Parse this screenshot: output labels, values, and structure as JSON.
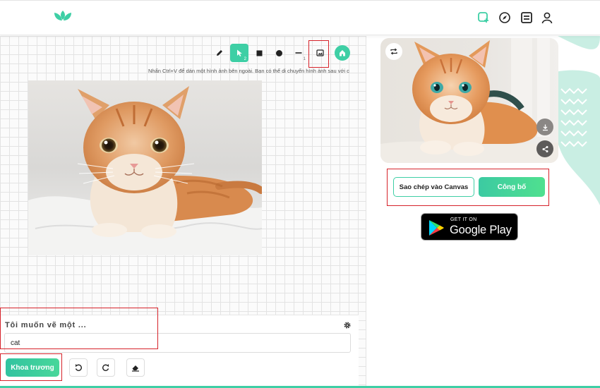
{
  "header": {
    "icons": [
      "logo-icon",
      "new-canvas-icon",
      "explore-icon",
      "gallery-icon",
      "user-icon"
    ]
  },
  "toolbar": {
    "tools": [
      "pencil-icon",
      "select-icon",
      "rectangle-icon",
      "circle-icon",
      "line-icon",
      "image-icon",
      "home-icon"
    ],
    "select_badge": "2",
    "line_badge": "1"
  },
  "canvas": {
    "hint": "Nhấn Ctrl+V để dán một hình ảnh bên ngoài. Bạn có thể di chuyển hình ảnh sau với c"
  },
  "prompt": {
    "label": "Tôi muốn vẽ một ...",
    "value": "cat",
    "generate_label": "Khoa trương"
  },
  "preview": {
    "copy_label": "Sao chép vào Canvas",
    "publish_label": "Công bố"
  },
  "google_play": {
    "small": "GET IT ON",
    "big": "Google Play"
  },
  "colors": {
    "accent": "#3ecfa5",
    "highlight": "#d6222a"
  }
}
